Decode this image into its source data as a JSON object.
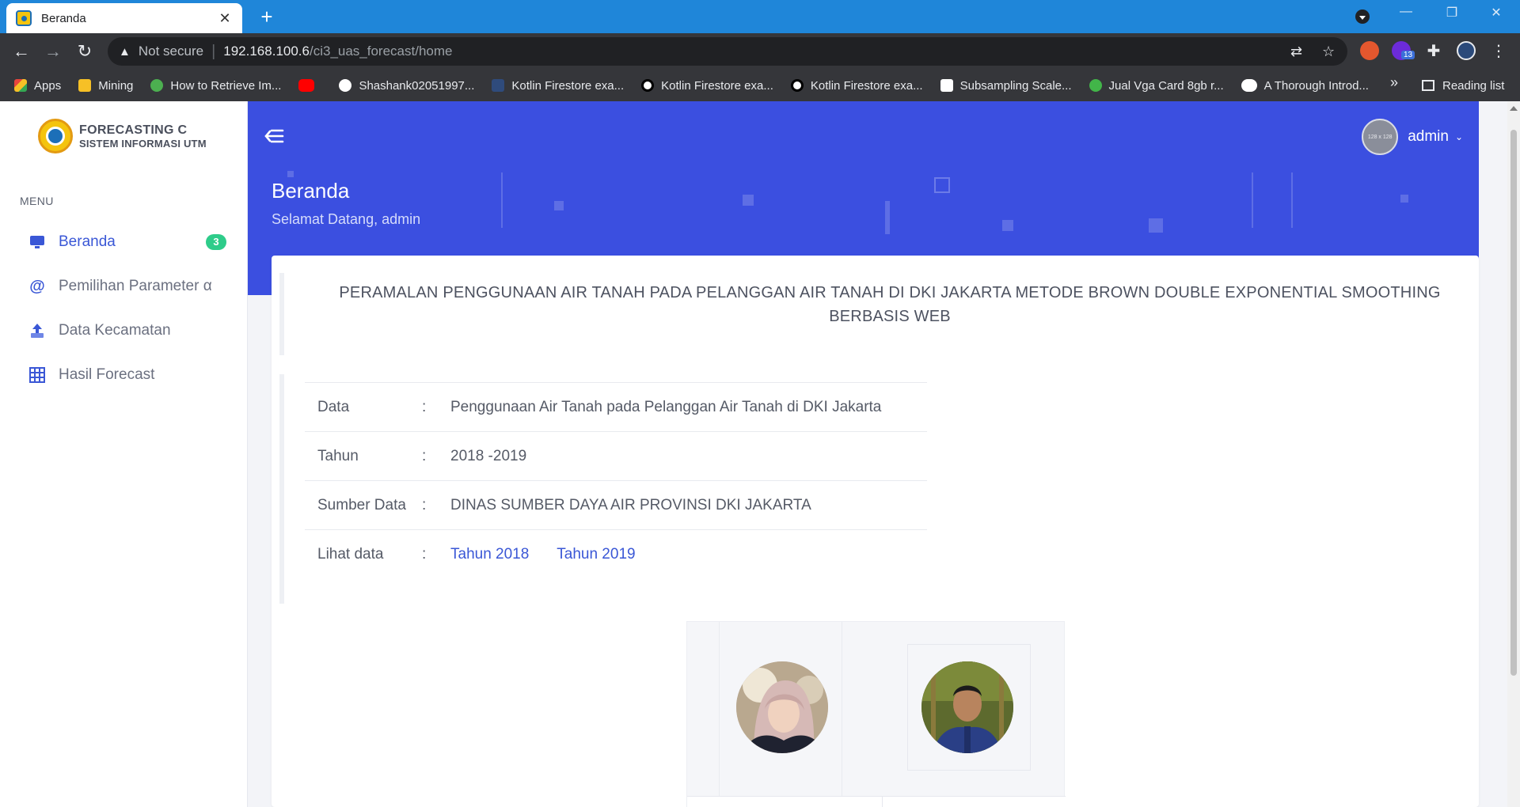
{
  "browser": {
    "tab_title": "Beranda",
    "tab_close": "✕",
    "new_tab": "+",
    "omnibox": {
      "security_label": "Not secure",
      "url_host": "192.168.100.6",
      "url_path": "/ci3_uas_forecast/home"
    },
    "extensions_badge": "13",
    "bookmarks": [
      {
        "label": "Apps",
        "icon": "apps-grid-icon",
        "color": "#e8453c"
      },
      {
        "label": "Mining",
        "icon": "folder-icon",
        "color": "#f6c026"
      },
      {
        "label": "How to Retrieve Im...",
        "icon": "link-icon",
        "color": "#4caf50"
      },
      {
        "label": "",
        "icon": "youtube-icon",
        "color": "#ff0000"
      },
      {
        "label": "Shashank02051997...",
        "icon": "github-icon",
        "color": "#ffffff"
      },
      {
        "label": "Kotlin Firestore exa...",
        "icon": "kotlin-icon",
        "color": "#2f4b7c"
      },
      {
        "label": "Kotlin Firestore exa...",
        "icon": "medium-icon",
        "color": "#ffffff"
      },
      {
        "label": "Kotlin Firestore exa...",
        "icon": "medium-icon",
        "color": "#ffffff"
      },
      {
        "label": "Subsampling Scale...",
        "icon": "page-icon",
        "color": "#ffffff"
      },
      {
        "label": "Jual Vga Card 8gb r...",
        "icon": "shop-icon",
        "color": "#42b549"
      },
      {
        "label": "A Thorough Introd...",
        "icon": "medium-icon",
        "color": "#ffffff"
      }
    ],
    "bookmarks_more": "»",
    "reading_list": "Reading list"
  },
  "sidebar": {
    "brand_line1": "FORECASTING C",
    "brand_line2": "SISTEM INFORMASI UTM",
    "menu_label": "MENU",
    "items": [
      {
        "label": "Beranda",
        "icon": "monitor-icon",
        "active": true,
        "badge": "3"
      },
      {
        "label": "Pemilihan Parameter α",
        "icon": "at-sign-icon",
        "active": false
      },
      {
        "label": "Data Kecamatan",
        "icon": "upload-icon",
        "active": false
      },
      {
        "label": "Hasil Forecast",
        "icon": "table-grid-icon",
        "active": false
      }
    ]
  },
  "header": {
    "username": "admin",
    "avatar_text": "128 x 128",
    "title": "Beranda",
    "subtitle": "Selamat Datang, admin"
  },
  "content": {
    "heading": "PERAMALAN PENGGUNAAN AIR TANAH PADA PELANGGAN AIR TANAH DI DKI JAKARTA METODE BROWN DOUBLE EXPONENTIAL SMOOTHING BERBASIS WEB",
    "separator": ":",
    "rows": [
      {
        "key": "Data",
        "value": "Penggunaan Air Tanah pada Pelanggan Air Tanah di DKI Jakarta"
      },
      {
        "key": "Tahun",
        "value": "2018 -2019"
      },
      {
        "key": "Sumber Data",
        "value": "DINAS SUMBER DAYA AIR PROVINSI DKI JAKARTA"
      }
    ],
    "links_row": {
      "key": "Lihat data",
      "links": [
        "Tahun 2018",
        "Tahun 2019"
      ]
    }
  },
  "colors": {
    "accent": "#3a57d6",
    "hero": "#3b4fe0",
    "badge": "#2ecc8a",
    "chrome_tabstrip": "#1f86d9",
    "chrome_toolbar": "#35363a"
  }
}
